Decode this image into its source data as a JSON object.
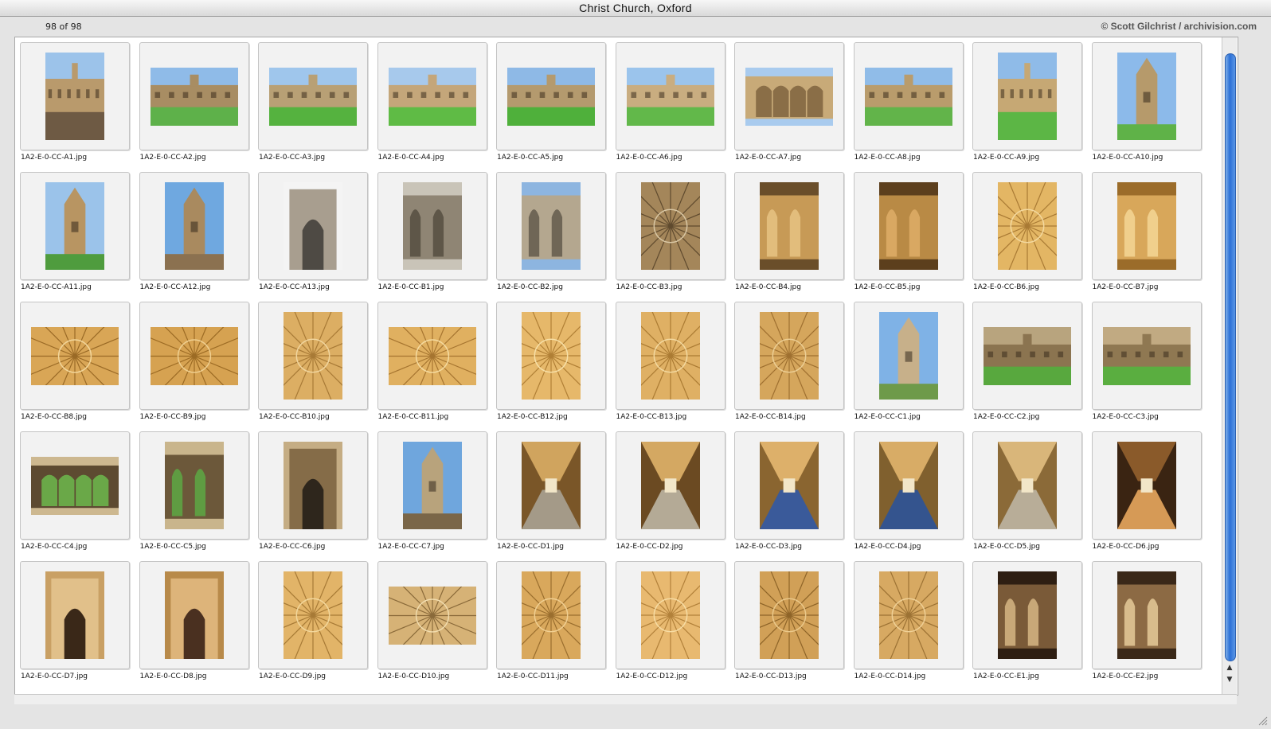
{
  "window": {
    "title": "Christ Church, Oxford",
    "count_text": "98 of 98",
    "copyright": "© Scott Gilchrist / archivision.com"
  },
  "scrollbar": {
    "up_icon": "triangle-up-icon",
    "down_icon": "triangle-down-icon"
  },
  "colors": {
    "scroll_thumb": "#2b6fd6",
    "background": "#e4e4e4"
  },
  "thumbnails": [
    {
      "name": "1A2-E-0-CC-A1.jpg",
      "orientation": "portrait",
      "subject": "street",
      "colors": [
        "#9cc3ea",
        "#b99a6c",
        "#6e5a44"
      ]
    },
    {
      "name": "1A2-E-0-CC-A2.jpg",
      "orientation": "landscape",
      "subject": "building-lawn",
      "colors": [
        "#8fbbe8",
        "#a88d63",
        "#5eb14a"
      ]
    },
    {
      "name": "1A2-E-0-CC-A3.jpg",
      "orientation": "landscape",
      "subject": "building-lawn",
      "colors": [
        "#9fc6ec",
        "#b8a075",
        "#55b23f"
      ]
    },
    {
      "name": "1A2-E-0-CC-A4.jpg",
      "orientation": "landscape",
      "subject": "building-lawn",
      "colors": [
        "#a7c9ec",
        "#c4a67a",
        "#5fbb45"
      ]
    },
    {
      "name": "1A2-E-0-CC-A5.jpg",
      "orientation": "landscape",
      "subject": "building-lawn",
      "colors": [
        "#8eb9e6",
        "#b49a6e",
        "#4fb03b"
      ]
    },
    {
      "name": "1A2-E-0-CC-A6.jpg",
      "orientation": "landscape",
      "subject": "building-lawn",
      "colors": [
        "#9bc4ec",
        "#c9ad80",
        "#62b84a"
      ]
    },
    {
      "name": "1A2-E-0-CC-A7.jpg",
      "orientation": "landscape",
      "subject": "facade",
      "colors": [
        "#a9cbee",
        "#c8aa78",
        "#8a6e47"
      ]
    },
    {
      "name": "1A2-E-0-CC-A8.jpg",
      "orientation": "landscape",
      "subject": "building-lawn",
      "colors": [
        "#90bce8",
        "#b99c6c",
        "#62b44a"
      ]
    },
    {
      "name": "1A2-E-0-CC-A9.jpg",
      "orientation": "portrait",
      "subject": "building-lawn",
      "colors": [
        "#8fbbe8",
        "#c6a874",
        "#5cb645"
      ]
    },
    {
      "name": "1A2-E-0-CC-A10.jpg",
      "orientation": "portrait",
      "subject": "tower",
      "colors": [
        "#8cbaea",
        "#b69a6b",
        "#5fb248"
      ]
    },
    {
      "name": "1A2-E-0-CC-A11.jpg",
      "orientation": "portrait",
      "subject": "tower",
      "colors": [
        "#9bc3ea",
        "#b89562",
        "#4f9c3e"
      ]
    },
    {
      "name": "1A2-E-0-CC-A12.jpg",
      "orientation": "portrait",
      "subject": "tower",
      "colors": [
        "#6fa8e0",
        "#a98a5f",
        "#8b7150"
      ]
    },
    {
      "name": "1A2-E-0-CC-A13.jpg",
      "orientation": "portrait",
      "subject": "gate",
      "colors": [
        "#f4f4f4",
        "#a89e8f",
        "#4e4a44"
      ]
    },
    {
      "name": "1A2-E-0-CC-B1.jpg",
      "orientation": "portrait",
      "subject": "facade",
      "colors": [
        "#c9c4b8",
        "#8f8574",
        "#5e5648"
      ]
    },
    {
      "name": "1A2-E-0-CC-B2.jpg",
      "orientation": "portrait",
      "subject": "facade",
      "colors": [
        "#8db5e0",
        "#b4a78f",
        "#6f6656"
      ]
    },
    {
      "name": "1A2-E-0-CC-B3.jpg",
      "orientation": "portrait",
      "subject": "vault",
      "colors": [
        "#5f4a2e",
        "#a4865a",
        "#d9c7a4"
      ]
    },
    {
      "name": "1A2-E-0-CC-B4.jpg",
      "orientation": "portrait",
      "subject": "interior",
      "colors": [
        "#6a4e2a",
        "#c79a56",
        "#e2bd7c"
      ]
    },
    {
      "name": "1A2-E-0-CC-B5.jpg",
      "orientation": "portrait",
      "subject": "interior",
      "colors": [
        "#5c3f1d",
        "#b98a45",
        "#d9a862"
      ]
    },
    {
      "name": "1A2-E-0-CC-B6.jpg",
      "orientation": "portrait",
      "subject": "vault",
      "colors": [
        "#a97a34",
        "#e3b664",
        "#f3d9a0"
      ]
    },
    {
      "name": "1A2-E-0-CC-B7.jpg",
      "orientation": "portrait",
      "subject": "interior",
      "colors": [
        "#9b6c2a",
        "#d8a75a",
        "#f0cf8c"
      ]
    },
    {
      "name": "1A2-E-0-CC-B8.jpg",
      "orientation": "landscape",
      "subject": "vault",
      "colors": [
        "#9a6a26",
        "#d9a656",
        "#f2d69b"
      ]
    },
    {
      "name": "1A2-E-0-CC-B9.jpg",
      "orientation": "landscape",
      "subject": "vault",
      "colors": [
        "#9c6b24",
        "#d6a251",
        "#efcf90"
      ]
    },
    {
      "name": "1A2-E-0-CC-B10.jpg",
      "orientation": "portrait",
      "subject": "vault",
      "colors": [
        "#a87a36",
        "#dcae63",
        "#f1d69f"
      ]
    },
    {
      "name": "1A2-E-0-CC-B11.jpg",
      "orientation": "landscape",
      "subject": "vault",
      "colors": [
        "#a67530",
        "#e0b060",
        "#f5dba0"
      ]
    },
    {
      "name": "1A2-E-0-CC-B12.jpg",
      "orientation": "portrait",
      "subject": "vault",
      "colors": [
        "#b07f35",
        "#e6b86a",
        "#f7e0a8"
      ]
    },
    {
      "name": "1A2-E-0-CC-B13.jpg",
      "orientation": "portrait",
      "subject": "vault",
      "colors": [
        "#ab7b33",
        "#dfb064",
        "#f3d9a0"
      ]
    },
    {
      "name": "1A2-E-0-CC-B14.jpg",
      "orientation": "portrait",
      "subject": "vault",
      "colors": [
        "#9f7030",
        "#d5a65c",
        "#ecce94"
      ]
    },
    {
      "name": "1A2-E-0-CC-C1.jpg",
      "orientation": "portrait",
      "subject": "tower",
      "colors": [
        "#7fb2e6",
        "#c7b08a",
        "#6e9a4a"
      ]
    },
    {
      "name": "1A2-E-0-CC-C2.jpg",
      "orientation": "landscape",
      "subject": "building-lawn",
      "colors": [
        "#b8a47e",
        "#8b7450",
        "#58a83e"
      ]
    },
    {
      "name": "1A2-E-0-CC-C3.jpg",
      "orientation": "landscape",
      "subject": "building-lawn",
      "colors": [
        "#c1aa82",
        "#8f7852",
        "#5aae40"
      ]
    },
    {
      "name": "1A2-E-0-CC-C4.jpg",
      "orientation": "landscape",
      "subject": "facade",
      "colors": [
        "#cdb890",
        "#5d4a31",
        "#6aa848"
      ]
    },
    {
      "name": "1A2-E-0-CC-C5.jpg",
      "orientation": "portrait",
      "subject": "facade",
      "colors": [
        "#c9b58c",
        "#6c583a",
        "#5f9c42"
      ]
    },
    {
      "name": "1A2-E-0-CC-C6.jpg",
      "orientation": "portrait",
      "subject": "gate",
      "colors": [
        "#c5ad84",
        "#856c48",
        "#2e261c"
      ]
    },
    {
      "name": "1A2-E-0-CC-C7.jpg",
      "orientation": "portrait",
      "subject": "tower",
      "colors": [
        "#6fa6dd",
        "#b8a37c",
        "#7a6648"
      ]
    },
    {
      "name": "1A2-E-0-CC-D1.jpg",
      "orientation": "portrait",
      "subject": "cloister",
      "colors": [
        "#7a5628",
        "#d0a45e",
        "#a49a88"
      ]
    },
    {
      "name": "1A2-E-0-CC-D2.jpg",
      "orientation": "portrait",
      "subject": "cloister",
      "colors": [
        "#6b4a22",
        "#d4a862",
        "#b4aa96"
      ]
    },
    {
      "name": "1A2-E-0-CC-D3.jpg",
      "orientation": "portrait",
      "subject": "cloister",
      "colors": [
        "#8a6530",
        "#ddb06a",
        "#3a5a9a"
      ]
    },
    {
      "name": "1A2-E-0-CC-D4.jpg",
      "orientation": "portrait",
      "subject": "cloister",
      "colors": [
        "#80602e",
        "#d8ac66",
        "#34548e"
      ]
    },
    {
      "name": "1A2-E-0-CC-D5.jpg",
      "orientation": "portrait",
      "subject": "cloister",
      "colors": [
        "#8b6a38",
        "#d9b67a",
        "#b8ad98"
      ]
    },
    {
      "name": "1A2-E-0-CC-D6.jpg",
      "orientation": "portrait",
      "subject": "cloister",
      "colors": [
        "#3a2412",
        "#8a5a2a",
        "#d69a56"
      ]
    },
    {
      "name": "1A2-E-0-CC-D7.jpg",
      "orientation": "portrait",
      "subject": "gate",
      "colors": [
        "#c9a064",
        "#e1c08a",
        "#3a2818"
      ]
    },
    {
      "name": "1A2-E-0-CC-D8.jpg",
      "orientation": "portrait",
      "subject": "gate",
      "colors": [
        "#b88a4a",
        "#ddb47a",
        "#4a3020"
      ]
    },
    {
      "name": "1A2-E-0-CC-D9.jpg",
      "orientation": "portrait",
      "subject": "vault",
      "colors": [
        "#a77a36",
        "#e2b468",
        "#f2d79c"
      ]
    },
    {
      "name": "1A2-E-0-CC-D10.jpg",
      "orientation": "landscape",
      "subject": "vault",
      "colors": [
        "#8a6a3a",
        "#d6b276",
        "#f1dcae"
      ]
    },
    {
      "name": "1A2-E-0-CC-D11.jpg",
      "orientation": "portrait",
      "subject": "vault",
      "colors": [
        "#9a6e2e",
        "#d9a85c",
        "#f0cf92"
      ]
    },
    {
      "name": "1A2-E-0-CC-D12.jpg",
      "orientation": "portrait",
      "subject": "vault",
      "colors": [
        "#b2813a",
        "#e8b970",
        "#f6dca4"
      ]
    },
    {
      "name": "1A2-E-0-CC-D13.jpg",
      "orientation": "portrait",
      "subject": "vault",
      "colors": [
        "#8e6428",
        "#d1a057",
        "#eac88a"
      ]
    },
    {
      "name": "1A2-E-0-CC-D14.jpg",
      "orientation": "portrait",
      "subject": "vault",
      "colors": [
        "#9c7234",
        "#d7a962",
        "#efd096"
      ]
    },
    {
      "name": "1A2-E-0-CC-E1.jpg",
      "orientation": "portrait",
      "subject": "interior",
      "colors": [
        "#2e1e12",
        "#7a5a38",
        "#c8a878"
      ]
    },
    {
      "name": "1A2-E-0-CC-E2.jpg",
      "orientation": "portrait",
      "subject": "interior",
      "colors": [
        "#3a2818",
        "#8c6a44",
        "#d8bc8c"
      ]
    }
  ]
}
